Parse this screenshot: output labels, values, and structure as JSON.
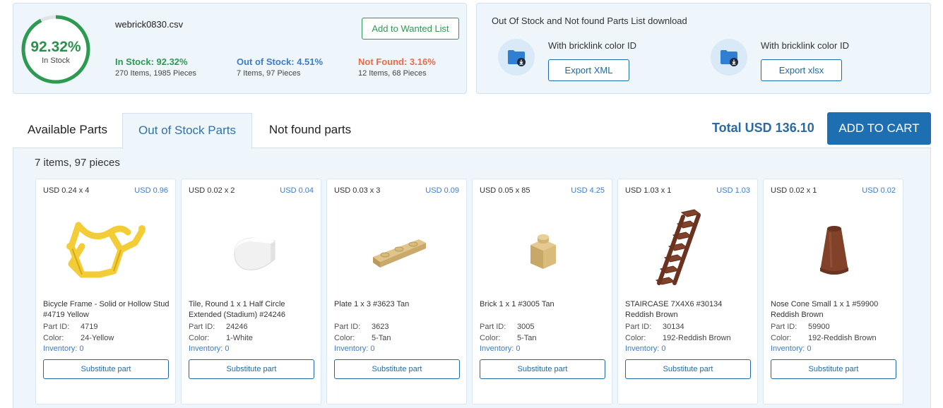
{
  "summary": {
    "ring_percent": "92.32%",
    "ring_fraction": 0.9232,
    "ring_label": "In Stock",
    "filename": "webrick0830.csv",
    "wanted_button": "Add to Wanted List",
    "in_stock": {
      "title": "In Stock: 92.32%",
      "detail": "270 Items, 1985 Pieces"
    },
    "out_of_stock": {
      "title": "Out of Stock: 4.51%",
      "detail": "7 Items, 97 Pieces"
    },
    "not_found": {
      "title": "Not Found: 3.16%",
      "detail": "12 Items, 68 Pieces"
    },
    "colors": {
      "green": "#2d9a51",
      "blue": "#3d7cc9",
      "orange": "#ef6a4a"
    }
  },
  "export": {
    "title": "Out Of Stock and Not found Parts List download",
    "xml": {
      "label": "With bricklink color ID",
      "button": "Export XML"
    },
    "xlsx": {
      "label": "With bricklink color ID",
      "button": "Export xlsx"
    }
  },
  "tabs": [
    {
      "label": "Available Parts"
    },
    {
      "label": "Out of Stock Parts",
      "active": true
    },
    {
      "label": "Not found parts"
    }
  ],
  "total": "Total USD 136.10",
  "add_to_cart": "ADD TO CART",
  "item_count": "7 items, 97 pieces",
  "labels": {
    "part_id": "Part ID:",
    "color": "Color:",
    "inventory": "Inventory:",
    "substitute": "Substitute part"
  },
  "cards": [
    {
      "price": "USD 0.24 x 4",
      "total": "USD 0.96",
      "name": "Bicycle Frame - Solid or Hollow Stud #4719 Yellow",
      "part_id": "4719",
      "color": "24-Yellow",
      "inventory": "0",
      "icon": "bicycle-frame-icon",
      "swatch": "#f2cd37"
    },
    {
      "price": "USD 0.02 x 2",
      "total": "USD 0.04",
      "name": "Tile, Round 1 x 1 Half Circle Extended (Stadium) #24246",
      "part_id": "24246",
      "color": "1-White",
      "inventory": "0",
      "icon": "half-circle-tile-icon",
      "swatch": "#ffffff"
    },
    {
      "price": "USD 0.03 x 3",
      "total": "USD 0.09",
      "name": "Plate 1 x 3 #3623 Tan",
      "part_id": "3623",
      "color": "5-Tan",
      "inventory": "0",
      "icon": "plate-1x3-icon",
      "swatch": "#d9bb7b"
    },
    {
      "price": "USD 0.05 x 85",
      "total": "USD 4.25",
      "name": "Brick 1 x 1 #3005 Tan",
      "part_id": "3005",
      "color": "5-Tan",
      "inventory": "0",
      "icon": "brick-1x1-icon",
      "swatch": "#d9bb7b"
    },
    {
      "price": "USD 1.03 x 1",
      "total": "USD 1.03",
      "name": "STAIRCASE 7X4X6 #30134 Reddish Brown",
      "part_id": "30134",
      "color": "192-Reddish Brown",
      "inventory": "0",
      "icon": "staircase-icon",
      "swatch": "#82422a"
    },
    {
      "price": "USD 0.02 x 1",
      "total": "USD 0.02",
      "name": "Nose Cone Small 1 x 1 #59900 Reddish Brown",
      "part_id": "59900",
      "color": "192-Reddish Brown",
      "inventory": "0",
      "icon": "nose-cone-icon",
      "swatch": "#82422a"
    }
  ]
}
